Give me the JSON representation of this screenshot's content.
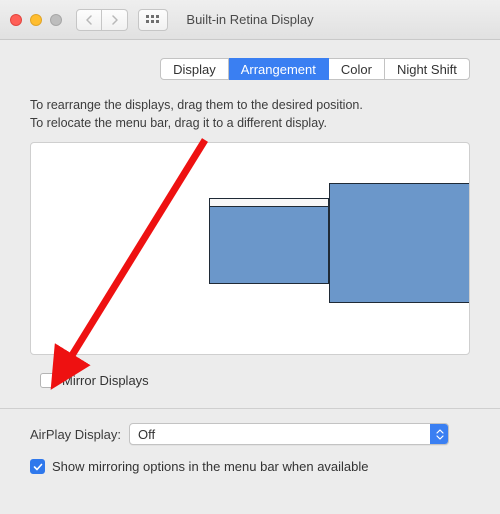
{
  "window": {
    "title": "Built-in Retina Display"
  },
  "tabs": {
    "display": "Display",
    "arrangement": "Arrangement",
    "color": "Color",
    "night_shift": "Night Shift"
  },
  "instructions": {
    "line1": "To rearrange the displays, drag them to the desired position.",
    "line2": "To relocate the menu bar, drag it to a different display."
  },
  "mirror": {
    "label": "Mirror Displays",
    "checked": false
  },
  "airplay": {
    "label": "AirPlay Display:",
    "selected": "Off"
  },
  "show_mirroring": {
    "label": "Show mirroring options in the menu bar when available",
    "checked": true
  },
  "colors": {
    "accent": "#3a7ff2",
    "display_fill": "#6b97ca"
  }
}
